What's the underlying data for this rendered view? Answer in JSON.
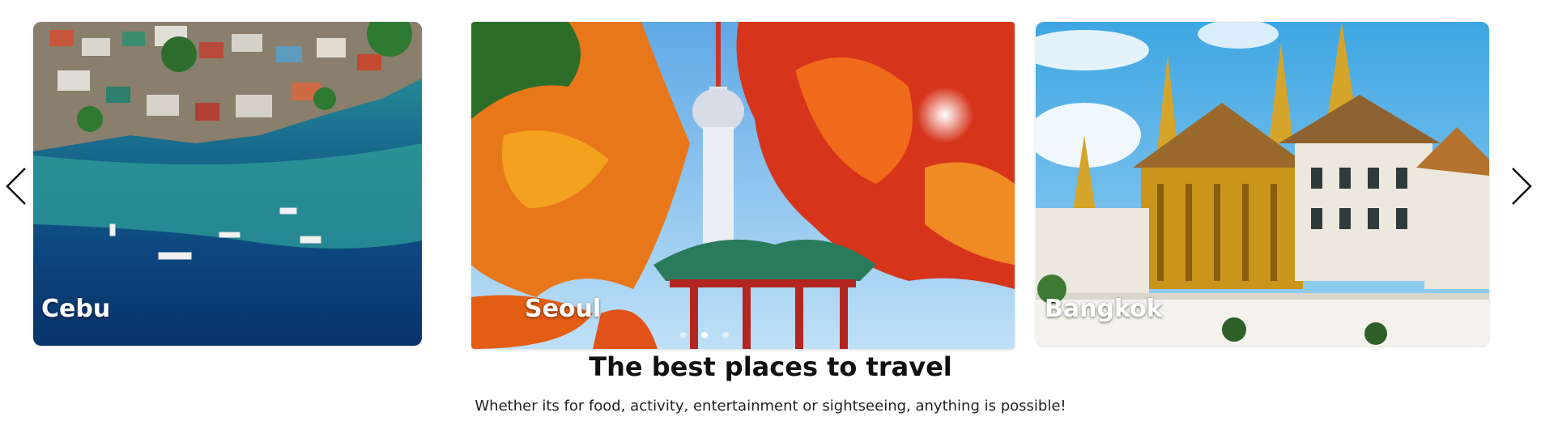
{
  "carousel": {
    "prev_icon": "chevron-left-icon",
    "next_icon": "chevron-right-icon",
    "slides": [
      {
        "label": "Cebu"
      },
      {
        "label": "Seoul"
      },
      {
        "label": "Bangkok"
      }
    ],
    "active_dot": 1,
    "dot_count": 3
  },
  "headline": "The best places to travel",
  "subline": "Whether its for food, activity, entertainment or sightseeing, anything is possible!",
  "colors": {
    "text_primary": "#111111",
    "card_label": "#ffffff",
    "ocean_deep": "#0b3f78",
    "autumn_orange": "#e35d12",
    "temple_gold": "#c9951b",
    "sky_blue": "#4eb5e8"
  }
}
